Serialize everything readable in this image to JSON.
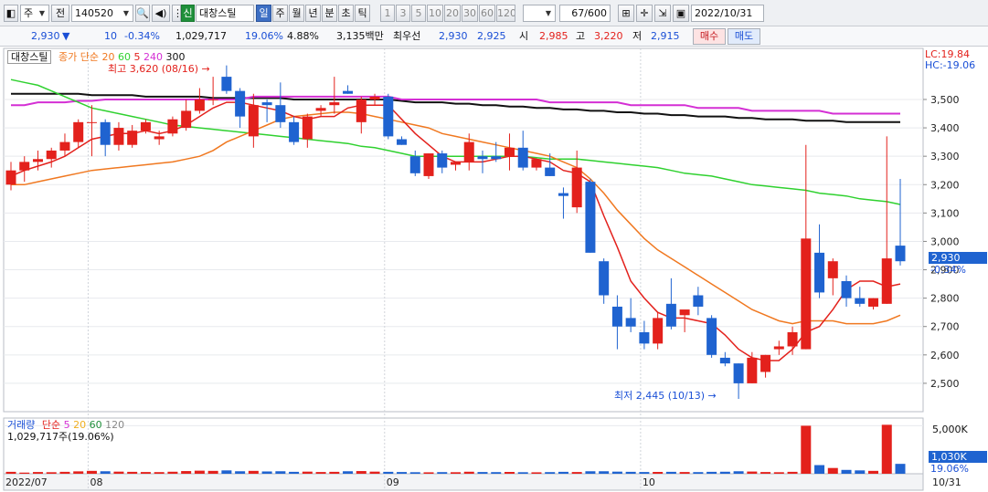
{
  "toolbar": {
    "period_label": "주",
    "prev_label": "전",
    "stock_code": "140520",
    "credit_badge": "신",
    "stock_name": "대창스틸",
    "tabs": [
      "일",
      "주",
      "월",
      "년",
      "분",
      "초",
      "틱"
    ],
    "active_tab": "일",
    "numbers": [
      "1",
      "3",
      "5",
      "10",
      "20",
      "30",
      "60",
      "120"
    ],
    "count": "67",
    "count_total": "/600",
    "date": "2022/10/31"
  },
  "quote": {
    "price": "2,930",
    "arrow": "▼",
    "change": "10",
    "change_rate": "-0.34%",
    "volume": "1,029,717",
    "volume_rate": "19.06%",
    "turnover": "4.88%",
    "amount": "3,135백만",
    "best_label": "최우선",
    "best_ask": "2,930",
    "best_bid": "2,925",
    "open_label": "시",
    "open": "2,985",
    "high_label": "고",
    "high": "3,220",
    "low_label": "저",
    "low": "2,915",
    "buy_label": "매수",
    "sell_label": "매도"
  },
  "chart_legend": {
    "name": "대창스틸",
    "price_label": "종가",
    "ma_type": "단순",
    "ma_periods": [
      "20",
      "60",
      "5",
      "240",
      "300"
    ],
    "lc": "LC:19.84",
    "hc": "HC:-19.06",
    "high_marker": "최고 3,620 (08/16)",
    "low_marker": "최저 2,445 (10/13)",
    "current_price_tag": "2,930",
    "current_rate_tag": "-0.34%"
  },
  "volume_legend": {
    "title": "거래량",
    "ma_type": "단순",
    "ma_periods": [
      "5",
      "20",
      "60",
      "120"
    ],
    "value": "1,029,717주(19.06%)",
    "axis_label": "5,000K",
    "current_tag": "1,030K",
    "current_rate": "19.06%"
  },
  "colors": {
    "up": "#e3211c",
    "down": "#1f63d0",
    "ma5": "#e3211c",
    "ma20": "#f07820",
    "ma60": "#2fd12f",
    "ma240": "#d42fd4",
    "ma300": "#111111"
  },
  "chart_data": {
    "type": "candlestick",
    "y_ticks": [
      2500,
      2600,
      2700,
      2800,
      2900,
      3000,
      3100,
      3200,
      3300,
      3400,
      3500
    ],
    "y_tick_labels": [
      "2,500",
      "2,600",
      "2,700",
      "2,800",
      "2,900",
      "3,000",
      "3,100",
      "3,200",
      "3,300",
      "3,400",
      "3,500"
    ],
    "ylim": [
      2400,
      3680
    ],
    "x_labels": [
      {
        "label": "2022/07",
        "index": 0
      },
      {
        "label": "08",
        "index": 6
      },
      {
        "label": "09",
        "index": 28
      },
      {
        "label": "10",
        "index": 47
      },
      {
        "label": "10/31",
        "index": 66
      }
    ],
    "candles": [
      {
        "o": 3200,
        "h": 3280,
        "l": 3180,
        "c": 3250
      },
      {
        "o": 3250,
        "h": 3300,
        "l": 3210,
        "c": 3280
      },
      {
        "o": 3280,
        "h": 3320,
        "l": 3250,
        "c": 3290
      },
      {
        "o": 3290,
        "h": 3330,
        "l": 3260,
        "c": 3320
      },
      {
        "o": 3320,
        "h": 3380,
        "l": 3300,
        "c": 3350
      },
      {
        "o": 3350,
        "h": 3430,
        "l": 3330,
        "c": 3420
      },
      {
        "o": 3420,
        "h": 3480,
        "l": 3300,
        "c": 3420
      },
      {
        "o": 3420,
        "h": 3430,
        "l": 3300,
        "c": 3340
      },
      {
        "o": 3340,
        "h": 3420,
        "l": 3320,
        "c": 3400
      },
      {
        "o": 3340,
        "h": 3410,
        "l": 3330,
        "c": 3390
      },
      {
        "o": 3390,
        "h": 3430,
        "l": 3380,
        "c": 3420
      },
      {
        "o": 3360,
        "h": 3390,
        "l": 3340,
        "c": 3370
      },
      {
        "o": 3380,
        "h": 3440,
        "l": 3370,
        "c": 3430
      },
      {
        "o": 3400,
        "h": 3500,
        "l": 3390,
        "c": 3460
      },
      {
        "o": 3460,
        "h": 3540,
        "l": 3450,
        "c": 3500
      },
      {
        "o": 3500,
        "h": 3580,
        "l": 3480,
        "c": 3500
      },
      {
        "o": 3580,
        "h": 3620,
        "l": 3520,
        "c": 3530
      },
      {
        "o": 3530,
        "h": 3540,
        "l": 3400,
        "c": 3440
      },
      {
        "o": 3370,
        "h": 3520,
        "l": 3330,
        "c": 3480
      },
      {
        "o": 3490,
        "h": 3500,
        "l": 3420,
        "c": 3480
      },
      {
        "o": 3480,
        "h": 3560,
        "l": 3400,
        "c": 3420
      },
      {
        "o": 3420,
        "h": 3440,
        "l": 3340,
        "c": 3350
      },
      {
        "o": 3360,
        "h": 3450,
        "l": 3330,
        "c": 3440
      },
      {
        "o": 3460,
        "h": 3480,
        "l": 3440,
        "c": 3470
      },
      {
        "o": 3480,
        "h": 3580,
        "l": 3450,
        "c": 3490
      },
      {
        "o": 3530,
        "h": 3550,
        "l": 3520,
        "c": 3520
      },
      {
        "o": 3420,
        "h": 3510,
        "l": 3380,
        "c": 3500
      },
      {
        "o": 3500,
        "h": 3520,
        "l": 3480,
        "c": 3510
      },
      {
        "o": 3510,
        "h": 3520,
        "l": 3360,
        "c": 3370
      },
      {
        "o": 3360,
        "h": 3370,
        "l": 3340,
        "c": 3340
      },
      {
        "o": 3300,
        "h": 3320,
        "l": 3230,
        "c": 3240
      },
      {
        "o": 3230,
        "h": 3310,
        "l": 3220,
        "c": 3310
      },
      {
        "o": 3310,
        "h": 3320,
        "l": 3240,
        "c": 3260
      },
      {
        "o": 3270,
        "h": 3280,
        "l": 3250,
        "c": 3280
      },
      {
        "o": 3280,
        "h": 3380,
        "l": 3250,
        "c": 3350
      },
      {
        "o": 3300,
        "h": 3320,
        "l": 3240,
        "c": 3290
      },
      {
        "o": 3300,
        "h": 3350,
        "l": 3280,
        "c": 3290
      },
      {
        "o": 3300,
        "h": 3380,
        "l": 3250,
        "c": 3330
      },
      {
        "o": 3330,
        "h": 3390,
        "l": 3250,
        "c": 3260
      },
      {
        "o": 3260,
        "h": 3290,
        "l": 3250,
        "c": 3290
      },
      {
        "o": 3260,
        "h": 3310,
        "l": 3230,
        "c": 3230
      },
      {
        "o": 3170,
        "h": 3190,
        "l": 3080,
        "c": 3160
      },
      {
        "o": 3120,
        "h": 3320,
        "l": 3100,
        "c": 3260
      },
      {
        "o": 3210,
        "h": 3220,
        "l": 2960,
        "c": 2960
      },
      {
        "o": 2930,
        "h": 2940,
        "l": 2780,
        "c": 2810
      },
      {
        "o": 2770,
        "h": 2810,
        "l": 2620,
        "c": 2700
      },
      {
        "o": 2730,
        "h": 2800,
        "l": 2680,
        "c": 2700
      },
      {
        "o": 2680,
        "h": 2720,
        "l": 2620,
        "c": 2640
      },
      {
        "o": 2640,
        "h": 2750,
        "l": 2620,
        "c": 2730
      },
      {
        "o": 2780,
        "h": 2870,
        "l": 2690,
        "c": 2700
      },
      {
        "o": 2740,
        "h": 2750,
        "l": 2680,
        "c": 2760
      },
      {
        "o": 2810,
        "h": 2840,
        "l": 2740,
        "c": 2770
      },
      {
        "o": 2730,
        "h": 2740,
        "l": 2590,
        "c": 2600
      },
      {
        "o": 2590,
        "h": 2610,
        "l": 2560,
        "c": 2570
      },
      {
        "o": 2570,
        "h": 2570,
        "l": 2445,
        "c": 2500
      },
      {
        "o": 2500,
        "h": 2610,
        "l": 2500,
        "c": 2590
      },
      {
        "o": 2540,
        "h": 2600,
        "l": 2520,
        "c": 2600
      },
      {
        "o": 2620,
        "h": 2650,
        "l": 2600,
        "c": 2630
      },
      {
        "o": 2630,
        "h": 2700,
        "l": 2600,
        "c": 2680
      },
      {
        "o": 2620,
        "h": 3340,
        "l": 2620,
        "c": 3010
      },
      {
        "o": 2960,
        "h": 3060,
        "l": 2800,
        "c": 2820
      },
      {
        "o": 2870,
        "h": 2940,
        "l": 2810,
        "c": 2930
      },
      {
        "o": 2860,
        "h": 2880,
        "l": 2770,
        "c": 2800
      },
      {
        "o": 2800,
        "h": 2840,
        "l": 2770,
        "c": 2780
      },
      {
        "o": 2770,
        "h": 2800,
        "l": 2760,
        "c": 2800
      },
      {
        "o": 2780,
        "h": 3370,
        "l": 2780,
        "c": 2940
      },
      {
        "o": 2985,
        "h": 3220,
        "l": 2915,
        "c": 2930
      }
    ],
    "ma5": [
      3230,
      3250,
      3265,
      3280,
      3300,
      3330,
      3360,
      3370,
      3380,
      3380,
      3390,
      3380,
      3390,
      3410,
      3440,
      3470,
      3490,
      3490,
      3480,
      3470,
      3460,
      3440,
      3430,
      3440,
      3440,
      3470,
      3480,
      3480,
      3480,
      3430,
      3380,
      3340,
      3300,
      3280,
      3280,
      3280,
      3290,
      3300,
      3300,
      3290,
      3280,
      3250,
      3240,
      3210,
      3090,
      2980,
      2860,
      2800,
      2750,
      2730,
      2730,
      2720,
      2710,
      2670,
      2620,
      2590,
      2580,
      2580,
      2620,
      2680,
      2700,
      2760,
      2830,
      2860,
      2860,
      2840,
      2850
    ],
    "ma20": [
      3200,
      3200,
      3210,
      3220,
      3230,
      3240,
      3250,
      3255,
      3260,
      3265,
      3270,
      3275,
      3280,
      3290,
      3300,
      3320,
      3350,
      3370,
      3390,
      3410,
      3430,
      3440,
      3445,
      3450,
      3455,
      3455,
      3450,
      3440,
      3430,
      3420,
      3410,
      3400,
      3380,
      3370,
      3360,
      3350,
      3340,
      3330,
      3320,
      3310,
      3300,
      3280,
      3260,
      3220,
      3170,
      3110,
      3060,
      3010,
      2970,
      2940,
      2910,
      2880,
      2850,
      2820,
      2790,
      2760,
      2740,
      2720,
      2710,
      2720,
      2720,
      2720,
      2710,
      2710,
      2710,
      2720,
      2740
    ],
    "ma60": [
      3570,
      3560,
      3550,
      3530,
      3510,
      3490,
      3470,
      3460,
      3450,
      3440,
      3430,
      3420,
      3410,
      3405,
      3400,
      3395,
      3390,
      3385,
      3380,
      3375,
      3370,
      3365,
      3360,
      3355,
      3350,
      3345,
      3335,
      3330,
      3320,
      3310,
      3300,
      3300,
      3300,
      3300,
      3300,
      3300,
      3300,
      3300,
      3300,
      3295,
      3290,
      3290,
      3290,
      3285,
      3280,
      3275,
      3270,
      3265,
      3260,
      3250,
      3240,
      3235,
      3230,
      3220,
      3210,
      3200,
      3195,
      3190,
      3185,
      3180,
      3170,
      3165,
      3160,
      3150,
      3145,
      3140,
      3130
    ],
    "ma240": [
      3480,
      3480,
      3490,
      3490,
      3490,
      3495,
      3495,
      3500,
      3500,
      3500,
      3500,
      3500,
      3500,
      3500,
      3500,
      3500,
      3500,
      3500,
      3510,
      3510,
      3510,
      3510,
      3510,
      3510,
      3510,
      3510,
      3510,
      3510,
      3510,
      3500,
      3500,
      3500,
      3500,
      3500,
      3500,
      3500,
      3500,
      3500,
      3500,
      3500,
      3490,
      3490,
      3490,
      3490,
      3490,
      3490,
      3480,
      3480,
      3480,
      3480,
      3480,
      3470,
      3470,
      3470,
      3470,
      3460,
      3460,
      3460,
      3460,
      3460,
      3460,
      3450,
      3450,
      3450,
      3450,
      3450,
      3450
    ],
    "ma300": [
      3520,
      3520,
      3520,
      3520,
      3520,
      3520,
      3515,
      3515,
      3515,
      3515,
      3510,
      3510,
      3510,
      3510,
      3510,
      3505,
      3505,
      3505,
      3505,
      3505,
      3505,
      3500,
      3500,
      3500,
      3500,
      3500,
      3500,
      3500,
      3500,
      3495,
      3490,
      3490,
      3490,
      3485,
      3485,
      3480,
      3480,
      3475,
      3475,
      3470,
      3470,
      3465,
      3465,
      3460,
      3460,
      3455,
      3455,
      3450,
      3450,
      3445,
      3445,
      3440,
      3440,
      3440,
      3435,
      3435,
      3430,
      3430,
      3430,
      3425,
      3425,
      3425,
      3420,
      3420,
      3420,
      3420,
      3420
    ],
    "volume": [
      200,
      120,
      180,
      160,
      200,
      250,
      300,
      260,
      220,
      200,
      180,
      170,
      210,
      280,
      320,
      300,
      350,
      260,
      300,
      240,
      260,
      200,
      220,
      180,
      200,
      260,
      280,
      220,
      200,
      180,
      160,
      150,
      170,
      160,
      210,
      180,
      170,
      190,
      160,
      150,
      170,
      200,
      180,
      260,
      260,
      220,
      200,
      180,
      190,
      200,
      180,
      170,
      200,
      210,
      260,
      230,
      180,
      160,
      200,
      5000,
      900,
      600,
      400,
      350,
      300,
      5100,
      1030
    ],
    "volume_ylim": [
      0,
      5800
    ]
  }
}
